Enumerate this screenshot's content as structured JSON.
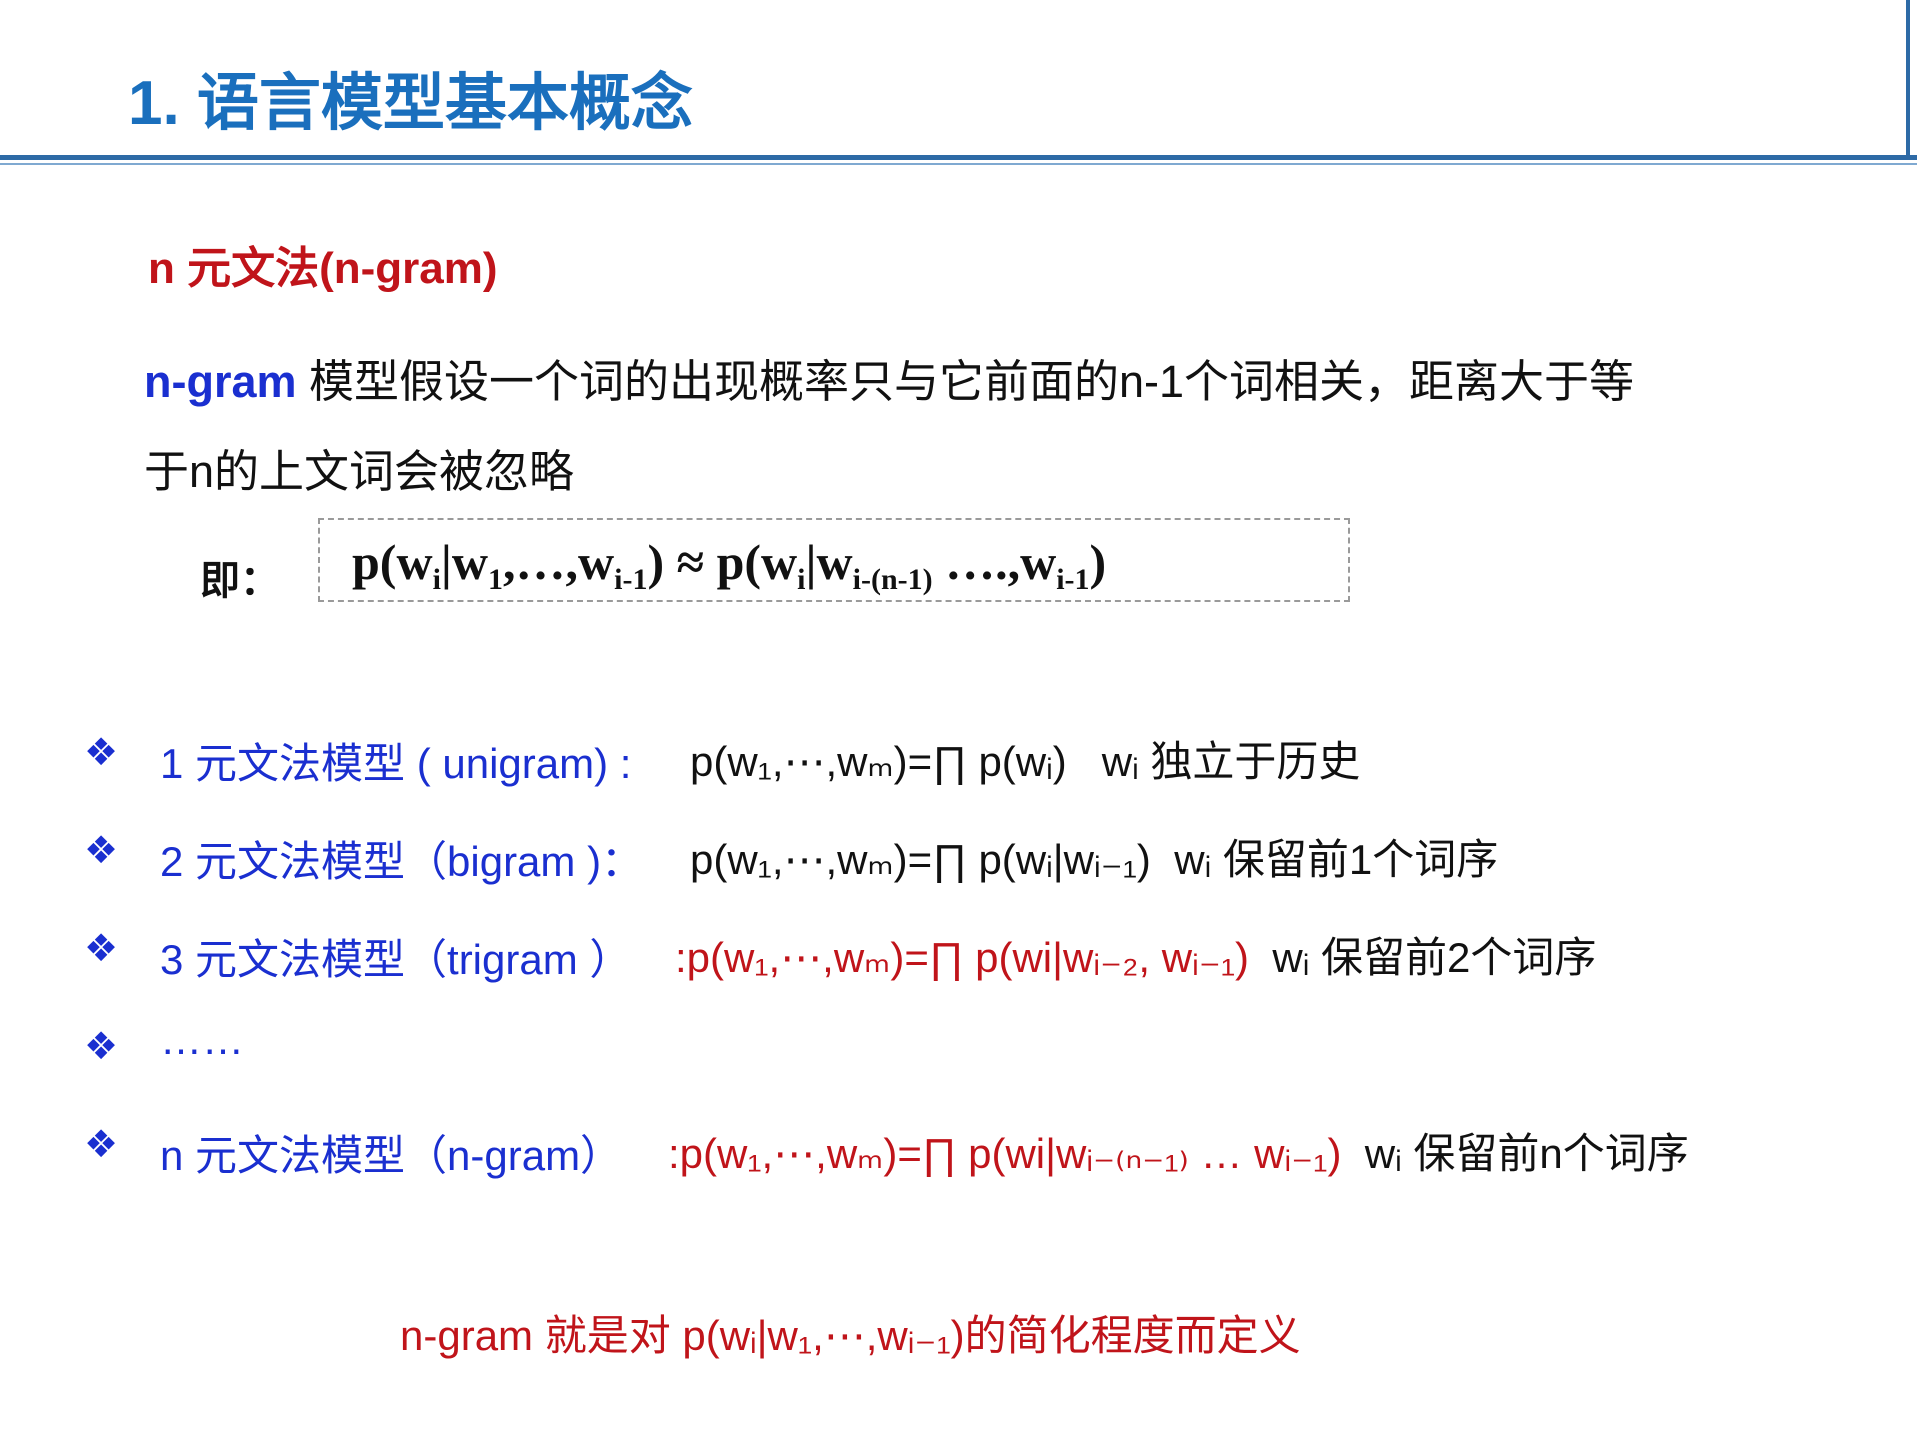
{
  "slide": {
    "title": "1. 语言模型基本概念",
    "subtitle": "n 元文法(n-gram)",
    "description": {
      "keyword": "n-gram",
      "line1_rest": " 模型假设一个词的出现概率只与它前面的n-1个词相关，距离大于等",
      "line2": "于n的上文词会被忽略"
    },
    "formula_prefix": "即：",
    "formula": {
      "lhs": "p(w",
      "lhs_i": "i",
      "lhs_mid": "|w",
      "lhs_1": "1",
      "lhs_dots": ",…,w",
      "lhs_im1": "i-1",
      "approx": ") ≈  p(w",
      "rhs_i": "i",
      "rhs_mid": "|w",
      "rhs_sub": "i-(n-1)",
      "rhs_dots": "  ….,w",
      "rhs_im1": "i-1",
      "close": ")"
    },
    "items": [
      {
        "label": "1 元文法模型 ( unigram) :",
        "formula": "p(w₁,⋯,wₘ)=∏ p(wᵢ)",
        "note": "wᵢ 独立于历史"
      },
      {
        "label": "2 元文法模型（bigram )：",
        "formula": "p(w₁,⋯,wₘ)=∏ p(wᵢ|wᵢ₋₁)",
        "note": "wᵢ 保留前1个词序"
      },
      {
        "label": "3 元文法模型（trigram ）",
        "formula": ":p(w₁,⋯,wₘ)=∏ p(wi|wᵢ₋₂, wᵢ₋₁)",
        "note": "wᵢ 保留前2个词序"
      },
      {
        "label": "……",
        "formula": "",
        "note": ""
      },
      {
        "label": "n 元文法模型（n-gram）",
        "formula": ":p(w₁,⋯,wₘ)=∏ p(wi|wᵢ₋₍ₙ₋₁₎ … wᵢ₋₁)",
        "note": "wᵢ 保留前n个词序"
      }
    ],
    "conclusion": "n-gram 就是对 p(wᵢ|w₁,⋯,wᵢ₋₁)的简化程度而定义"
  },
  "colors": {
    "title": "#1a6fbd",
    "accent_red": "#c0141a",
    "accent_blue": "#1a2fd0",
    "rule": "#2d6aa6"
  },
  "icons": {
    "bullet": "four-diamond-bullet-icon"
  }
}
